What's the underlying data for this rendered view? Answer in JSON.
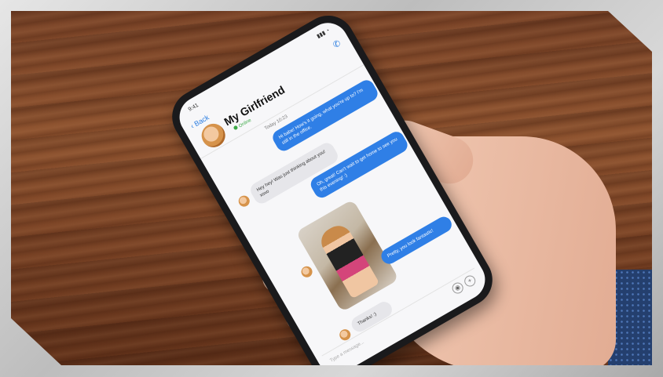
{
  "chat": {
    "status_time": "9:41",
    "status_icons": "▮▮▮ ◔",
    "back_label": "‹ Back",
    "contact_name": "My Girlfriend",
    "presence": "Online",
    "call_icon": "phone-icon",
    "timestamp": "Today 10:23",
    "messages": [
      {
        "from": "me",
        "text": "Hi babe! How's it going, what you're up to? I'm still in the office."
      },
      {
        "from": "her",
        "text": "Hey hey! Was just thinking about you! xoxo"
      },
      {
        "from": "me",
        "text": "Oh, great! Can't wait to get home to see you this evening! :)"
      },
      {
        "from": "her",
        "type": "photo"
      },
      {
        "from": "me",
        "text": "Pretty, you look fantastic!"
      },
      {
        "from": "her",
        "text": "Thanks! :)"
      }
    ],
    "composer_placeholder": "Type a message..."
  }
}
